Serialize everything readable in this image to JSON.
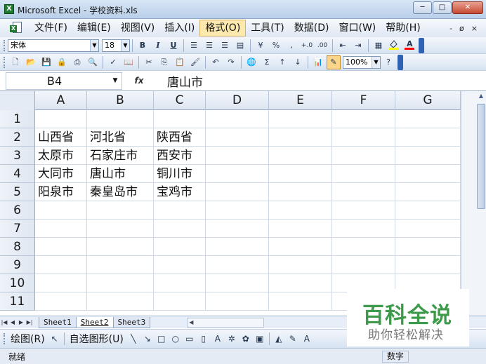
{
  "window": {
    "title": "Microsoft Excel - 学校资料.xls",
    "app_icon": "X",
    "buttons": [
      "─",
      "□",
      "✕"
    ]
  },
  "menu": {
    "items": [
      "文件(F)",
      "编辑(E)",
      "视图(V)",
      "插入(I)",
      "格式(O)",
      "工具(T)",
      "数据(D)",
      "窗口(W)",
      "帮助(H)"
    ],
    "hovered": "格式(O)",
    "mdi_buttons": [
      "-",
      "ø",
      "×"
    ]
  },
  "formatting_toolbar": {
    "font_name": "宋体",
    "font_size": "18",
    "bold": "B",
    "italic": "I",
    "underline": "U",
    "percent": "%",
    "comma": ",",
    "fill_color": "#ffff00",
    "font_color": "#ff0000"
  },
  "standard_toolbar": {
    "zoom": "100%",
    "sum_symbol": "Σ"
  },
  "formula_bar": {
    "name_box": "B4",
    "fx": "fx",
    "formula": "唐山市"
  },
  "grid": {
    "columns": [
      "A",
      "B",
      "C",
      "D",
      "E",
      "F",
      "G"
    ],
    "rows": [
      "1",
      "2",
      "3",
      "4",
      "5",
      "6",
      "7",
      "8",
      "9",
      "10",
      "11"
    ],
    "cells": [
      [
        "",
        "",
        "",
        "",
        "",
        "",
        ""
      ],
      [
        "山西省",
        "河北省",
        "陕西省",
        "",
        "",
        "",
        ""
      ],
      [
        "太原市",
        "石家庄市",
        "西安市",
        "",
        "",
        "",
        ""
      ],
      [
        "大同市",
        "唐山市",
        "铜川市",
        "",
        "",
        "",
        ""
      ],
      [
        "阳泉市",
        "秦皇岛市",
        "宝鸡市",
        "",
        "",
        "",
        ""
      ],
      [
        "",
        "",
        "",
        "",
        "",
        "",
        ""
      ],
      [
        "",
        "",
        "",
        "",
        "",
        "",
        ""
      ],
      [
        "",
        "",
        "",
        "",
        "",
        "",
        ""
      ],
      [
        "",
        "",
        "",
        "",
        "",
        "",
        ""
      ],
      [
        "",
        "",
        "",
        "",
        "",
        "",
        ""
      ],
      [
        "",
        "",
        "",
        "",
        "",
        "",
        ""
      ]
    ]
  },
  "sheet_tabs": {
    "tabs": [
      "Sheet1",
      "Sheet2",
      "Sheet3"
    ],
    "active": "Sheet2"
  },
  "drawing_toolbar": {
    "draw_menu": "绘图(R)",
    "autoshapes_menu": "自选图形(U)"
  },
  "status_bar": {
    "left": "就绪",
    "right": "数字"
  },
  "watermark": {
    "title": "百科全说",
    "subtitle": "助你轻松解决"
  },
  "colors": {
    "accent": "#3d9a4a",
    "titlebar": "#c7d8ee",
    "hover": "#fde9ad"
  }
}
